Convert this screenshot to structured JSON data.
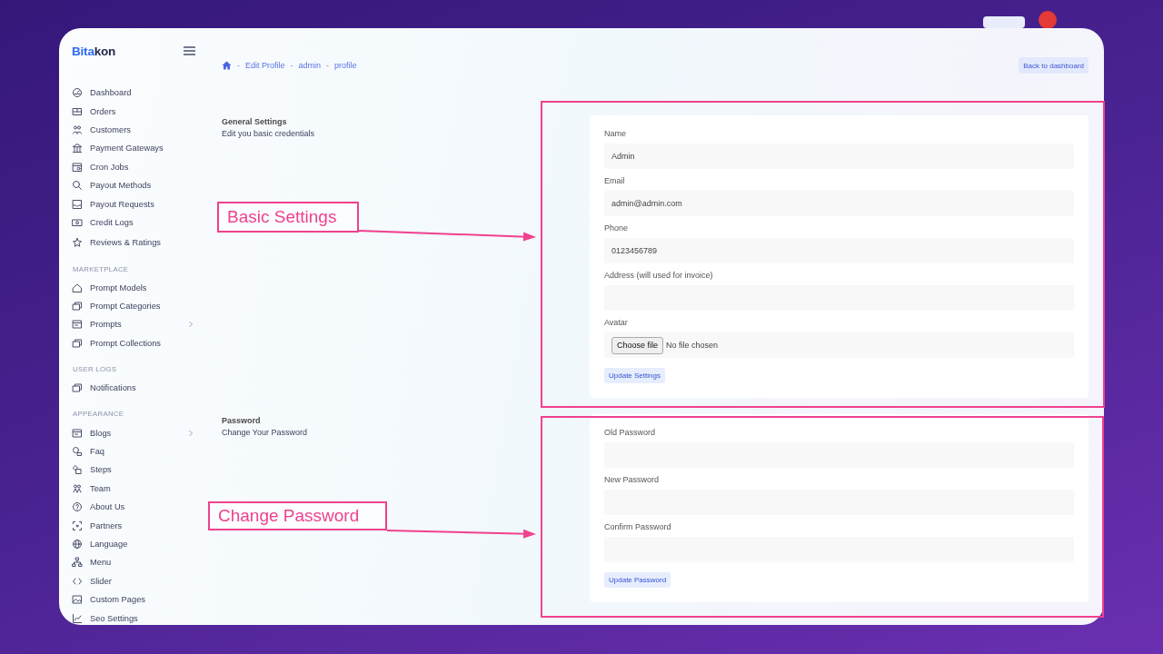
{
  "brand": {
    "prefix": "Bita",
    "suffix": "kon"
  },
  "sidebar": {
    "groups": [
      {
        "items": [
          {
            "label": "Dashboard",
            "expandable": false
          },
          {
            "label": "Orders",
            "expandable": false
          },
          {
            "label": "Customers",
            "expandable": false
          },
          {
            "label": "Payment Gateways",
            "expandable": false
          },
          {
            "label": "Cron Jobs",
            "expandable": false
          },
          {
            "label": "Payout Methods",
            "expandable": false
          },
          {
            "label": "Payout Requests",
            "expandable": false
          },
          {
            "label": "Credit Logs",
            "expandable": false
          },
          {
            "label": "Reviews & Ratings",
            "expandable": false
          }
        ]
      },
      {
        "heading": "MARKETPLACE",
        "items": [
          {
            "label": "Prompt Models",
            "expandable": false
          },
          {
            "label": "Prompt Categories",
            "expandable": false
          },
          {
            "label": "Prompts",
            "expandable": true
          },
          {
            "label": "Prompt Collections",
            "expandable": false
          }
        ]
      },
      {
        "heading": "USER LOGS",
        "items": [
          {
            "label": "Notifications",
            "expandable": false
          }
        ]
      },
      {
        "heading": "APPEARANCE",
        "items": [
          {
            "label": "Blogs",
            "expandable": true
          },
          {
            "label": "Faq",
            "expandable": false
          },
          {
            "label": "Steps",
            "expandable": false
          },
          {
            "label": "Team",
            "expandable": false
          },
          {
            "label": "About Us",
            "expandable": false
          },
          {
            "label": "Partners",
            "expandable": false
          },
          {
            "label": "Language",
            "expandable": false
          },
          {
            "label": "Menu",
            "expandable": false
          },
          {
            "label": "Slider",
            "expandable": false
          },
          {
            "label": "Custom Pages",
            "expandable": false
          },
          {
            "label": "Seo Settings",
            "expandable": false
          }
        ]
      }
    ]
  },
  "breadcrumb": {
    "separator": "-",
    "items": [
      "Edit Profile",
      "admin",
      "profile"
    ]
  },
  "header_button": "Back to dashboard",
  "sections": [
    {
      "title": "General Settings",
      "subtitle": "Edit you basic credentials",
      "annotation": "Basic Settings",
      "submit": "Update Settings",
      "fields": [
        {
          "kind": "text",
          "label": "Name",
          "value": "Admin"
        },
        {
          "kind": "text",
          "label": "Email",
          "value": "admin@admin.com"
        },
        {
          "kind": "text",
          "label": "Phone",
          "value": "0123456789"
        },
        {
          "kind": "text",
          "label": "Address (will used for invoice)"
        },
        {
          "kind": "file",
          "label": "Avatar",
          "button": "Choose file",
          "status": "No file chosen"
        }
      ]
    },
    {
      "title": "Password",
      "subtitle": "Change Your Password",
      "annotation": "Change Password",
      "submit": "Update Password",
      "fields": [
        {
          "kind": "text",
          "label": "Old Password"
        },
        {
          "kind": "text",
          "label": "New Password"
        },
        {
          "kind": "text",
          "label": "Confirm Password"
        }
      ]
    }
  ]
}
